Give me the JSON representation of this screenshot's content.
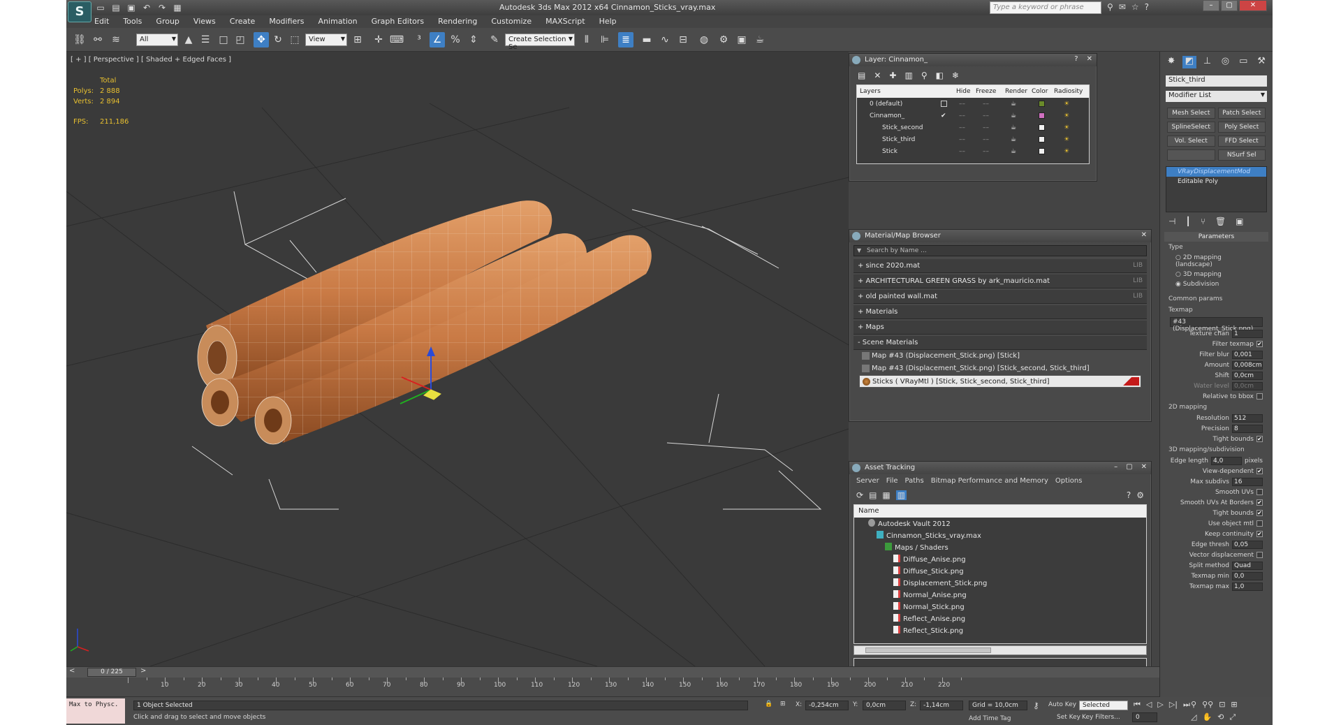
{
  "app": {
    "logo": "S",
    "title": "Autodesk 3ds Max  2012 x64     Cinnamon_Sticks_vray.max",
    "search_placeholder": "Type a keyword or phrase"
  },
  "menu": [
    "Edit",
    "Tools",
    "Group",
    "Views",
    "Create",
    "Modifiers",
    "Animation",
    "Graph Editors",
    "Rendering",
    "Customize",
    "MAXScript",
    "Help"
  ],
  "toolbar": {
    "selection_filter": "All",
    "ref_coord": "View",
    "named_selection": "Create Selection Se"
  },
  "viewport": {
    "label": "[ + ] [ Perspective ] [ Shaded + Edged Faces ]",
    "stats_header": "Total",
    "polys_label": "Polys:",
    "polys_value": "2 888",
    "verts_label": "Verts:",
    "verts_value": "2 894",
    "fps_label": "FPS:",
    "fps_value": "211,186"
  },
  "layer_dialog": {
    "title": "Layer: Cinnamon_",
    "columns": [
      "Layers",
      "Hide",
      "Freeze",
      "Render",
      "Color",
      "Radiosity"
    ],
    "rows": [
      {
        "name": "0 (default)",
        "color": "#6a8a2a"
      },
      {
        "name": "Cinnamon_",
        "color": "#d070c0"
      },
      {
        "name": "Stick_second",
        "color": "#f0f0f0"
      },
      {
        "name": "Stick_third",
        "color": "#f0f0f0"
      },
      {
        "name": "Stick",
        "color": "#f0f0f0"
      }
    ]
  },
  "material_browser": {
    "title": "Material/Map Browser",
    "search_placeholder": "Search by Name ...",
    "groups": [
      {
        "label": "+ since 2020.mat",
        "lib": "LIB"
      },
      {
        "label": "+ ARCHITECTURAL GREEN GRASS by ark_mauricio.mat",
        "lib": "LIB"
      },
      {
        "label": "+ old painted wall.mat",
        "lib": "LIB"
      },
      {
        "label": "+ Materials",
        "lib": ""
      },
      {
        "label": "+ Maps",
        "lib": ""
      },
      {
        "label": "- Scene Materials",
        "lib": ""
      }
    ],
    "scene_items": [
      "Map #43 (Displacement_Stick.png)  [Stick]",
      "Map #43 (Displacement_Stick.png)  [Stick_second, Stick_third]",
      "Sticks  ( VRayMtl )  [Stick, Stick_second, Stick_third]"
    ]
  },
  "asset_tracking": {
    "title": "Asset Tracking",
    "menu": [
      "Server",
      "File",
      "Paths",
      "Bitmap Performance and Memory",
      "Options"
    ],
    "column": "Name",
    "rows": [
      {
        "label": "Autodesk Vault 2012",
        "indent": 0,
        "icon": "vault"
      },
      {
        "label": "Cinnamon_Sticks_vray.max",
        "indent": 1,
        "icon": "file"
      },
      {
        "label": "Maps / Shaders",
        "indent": 2,
        "icon": "folder"
      },
      {
        "label": "Diffuse_Anise.png",
        "indent": 3,
        "icon": "img"
      },
      {
        "label": "Diffuse_Stick.png",
        "indent": 3,
        "icon": "img"
      },
      {
        "label": "Displacement_Stick.png",
        "indent": 3,
        "icon": "img"
      },
      {
        "label": "Normal_Anise.png",
        "indent": 3,
        "icon": "img"
      },
      {
        "label": "Normal_Stick.png",
        "indent": 3,
        "icon": "img"
      },
      {
        "label": "Reflect_Anise.png",
        "indent": 3,
        "icon": "img"
      },
      {
        "label": "Reflect_Stick.png",
        "indent": 3,
        "icon": "img"
      }
    ]
  },
  "command_panel": {
    "object_name": "Stick_third",
    "modifier_list": "Modifier List",
    "buttons": [
      "Mesh Select",
      "Patch Select",
      "SplineSelect",
      "Poly Select",
      "Vol. Select",
      "FFD Select",
      "",
      "NSurf Sel"
    ],
    "stack": [
      "VRayDisplacementMod",
      "Editable Poly"
    ],
    "params_title": "Parameters",
    "type_label": "Type",
    "types": [
      "2D mapping (landscape)",
      "3D mapping",
      "Subdivision"
    ],
    "common_label": "Common params",
    "texmap_label": "Texmap",
    "texmap_value": "#43 (Displacement_Stick.png)",
    "rows": [
      {
        "label": "Texture chan",
        "value": "1",
        "dim": false
      },
      {
        "label": "Filter texmap",
        "check": "✔",
        "dim": false
      },
      {
        "label": "Filter blur",
        "value": "0,001",
        "dim": false
      },
      {
        "label": "Amount",
        "value": "0,008cm",
        "dim": false
      },
      {
        "label": "Shift",
        "value": "0,0cm",
        "dim": false
      },
      {
        "label": "Water level",
        "value": "0,0cm",
        "dim": true
      },
      {
        "label": "Relative to bbox",
        "check": "",
        "dim": false
      }
    ],
    "mapping2d_label": "2D mapping",
    "rows2d": [
      {
        "label": "Resolution",
        "value": "512"
      },
      {
        "label": "Precision",
        "value": "8"
      },
      {
        "label": "Tight bounds",
        "check": "✔"
      }
    ],
    "subdiv_label": "3D mapping/subdivision",
    "rows3d": [
      {
        "label": "Edge length",
        "value": "4,0",
        "suffix": "pixels"
      },
      {
        "label": "View-dependent",
        "check": "✔"
      },
      {
        "label": "Max subdivs",
        "value": "16"
      },
      {
        "label": "Smooth UVs",
        "check": ""
      },
      {
        "label": "Smooth UVs At Borders",
        "check": "✔"
      },
      {
        "label": "Tight bounds",
        "check": "✔"
      },
      {
        "label": "Use object mtl",
        "check": ""
      },
      {
        "label": "Keep continuity",
        "check": "✔"
      },
      {
        "label": "Edge thresh",
        "value": "0,05"
      },
      {
        "label": "Vector displacement",
        "check": ""
      },
      {
        "label": "Split method",
        "value": "Quad"
      },
      {
        "label": "Texmap min",
        "value": "0,0"
      },
      {
        "label": "Texmap max",
        "value": "1,0"
      }
    ]
  },
  "timeline": {
    "frame": "0 / 225",
    "ticks": [
      "10",
      "20",
      "30",
      "40",
      "50",
      "60",
      "70",
      "80",
      "90",
      "100",
      "110",
      "120",
      "130",
      "140",
      "150",
      "160",
      "170",
      "180",
      "190",
      "200",
      "210",
      "220"
    ]
  },
  "status": {
    "maxscript": "Max to Physc.",
    "selected": "1 Object Selected",
    "prompt": "Click and drag to select and move objects",
    "x_label": "X:",
    "x": "-0,254cm",
    "y_label": "Y:",
    "y": "0,0cm",
    "z_label": "Z:",
    "z": "-1,14cm",
    "grid": "Grid = 10,0cm",
    "auto_key": "Auto Key",
    "key_mode": "Selected",
    "set_key": "Set Key",
    "key_filters": "Key Filters...",
    "add_time_tag": "Add Time Tag",
    "frame_field": "0"
  }
}
